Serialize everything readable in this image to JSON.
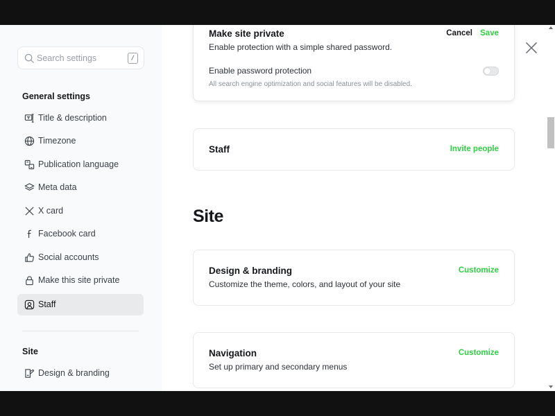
{
  "search": {
    "placeholder": "Search settings",
    "shortcut": "/"
  },
  "sidebar": {
    "general_title": "General settings",
    "items": [
      {
        "label": "Title & description",
        "icon": "title-icon"
      },
      {
        "label": "Timezone",
        "icon": "globe-icon"
      },
      {
        "label": "Publication language",
        "icon": "translate-icon"
      },
      {
        "label": "Meta data",
        "icon": "layers-icon"
      },
      {
        "label": "X card",
        "icon": "x-logo-icon"
      },
      {
        "label": "Facebook card",
        "icon": "facebook-icon"
      },
      {
        "label": "Social accounts",
        "icon": "thumbs-up-icon"
      },
      {
        "label": "Make this site private",
        "icon": "lock-icon"
      },
      {
        "label": "Staff",
        "icon": "staff-icon",
        "active": true
      }
    ],
    "site_title": "Site",
    "site_items": [
      {
        "label": "Design & branding",
        "icon": "brush-icon"
      }
    ]
  },
  "private_card": {
    "title": "Make site private",
    "description": "Enable protection with a simple shared password.",
    "cancel_label": "Cancel",
    "save_label": "Save",
    "option_label": "Enable password protection",
    "option_hint": "All search engine optimization and social features will be disabled.",
    "toggle_on": false
  },
  "staff_card": {
    "title": "Staff",
    "action_label": "Invite people"
  },
  "site_heading": "Site",
  "design_card": {
    "title": "Design & branding",
    "description": "Customize the theme, colors, and layout of your site",
    "action_label": "Customize"
  },
  "navigation_card": {
    "title": "Navigation",
    "description": "Set up primary and secondary menus",
    "action_label": "Customize"
  },
  "colors": {
    "accent_green": "#30cf43",
    "sidebar_bg": "#f9fafb",
    "active_item_bg": "#e9eaec"
  }
}
